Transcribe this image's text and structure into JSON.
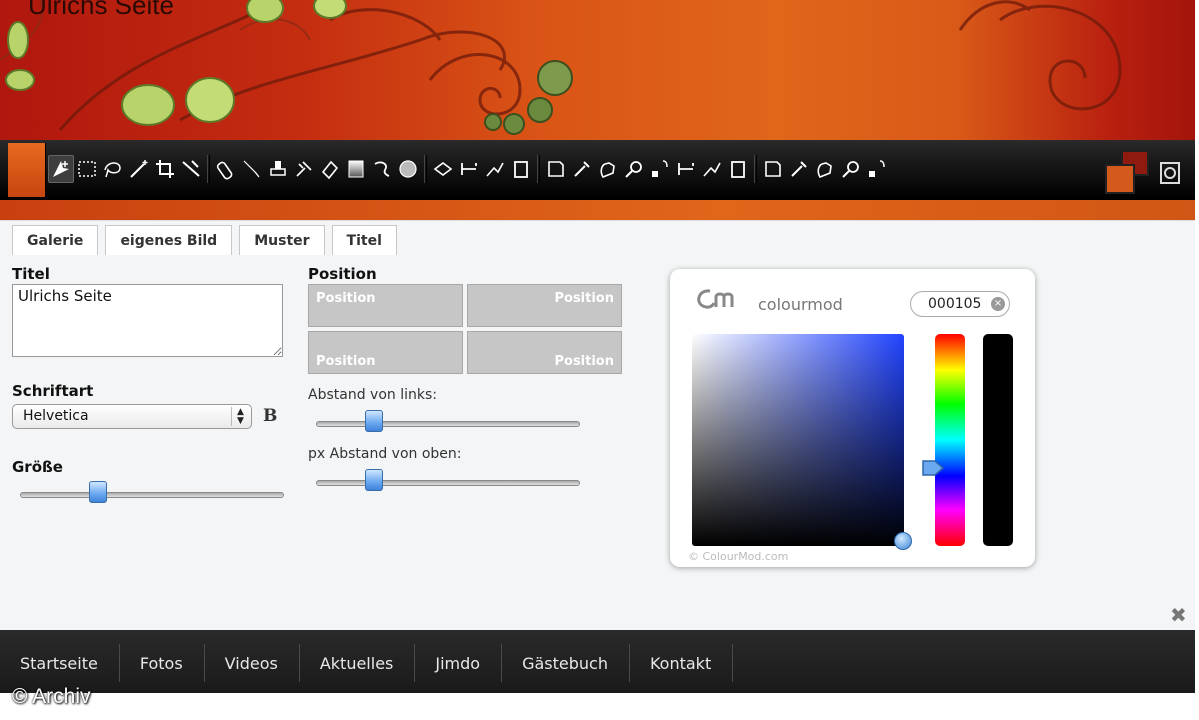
{
  "site": {
    "title": "Ulrichs Seite"
  },
  "tabs": [
    {
      "label": "Galerie"
    },
    {
      "label": "eigenes Bild"
    },
    {
      "label": "Muster"
    },
    {
      "label": "Titel"
    }
  ],
  "form": {
    "title_label": "Titel",
    "title_value": "Ulrichs Seite",
    "font_label": "Schriftart",
    "font_value": "Helvetica",
    "bold_label": "B",
    "size_label": "Größe",
    "size_slider": 0.28,
    "position_label": "Position",
    "position_cells": [
      "Position",
      "Position",
      "Position",
      "Position"
    ],
    "left_label": "Abstand von links:",
    "left_slider": 0.2,
    "top_label": "px Abstand von oben:",
    "top_slider": 0.2
  },
  "picker": {
    "brand": "colourmod",
    "hex_value": "000105",
    "credit": "© ColourMod.com"
  },
  "nav": {
    "items": [
      "Startseite",
      "Fotos",
      "Videos",
      "Aktuelles",
      "Jimdo",
      "Gästebuch",
      "Kontakt"
    ]
  },
  "watermark": "© Archiv",
  "colors": {
    "accent_orange": "#e0661a",
    "accent_red": "#b0170e",
    "swatch_front": "#d35a1c",
    "swatch_back": "#8e1a10"
  }
}
